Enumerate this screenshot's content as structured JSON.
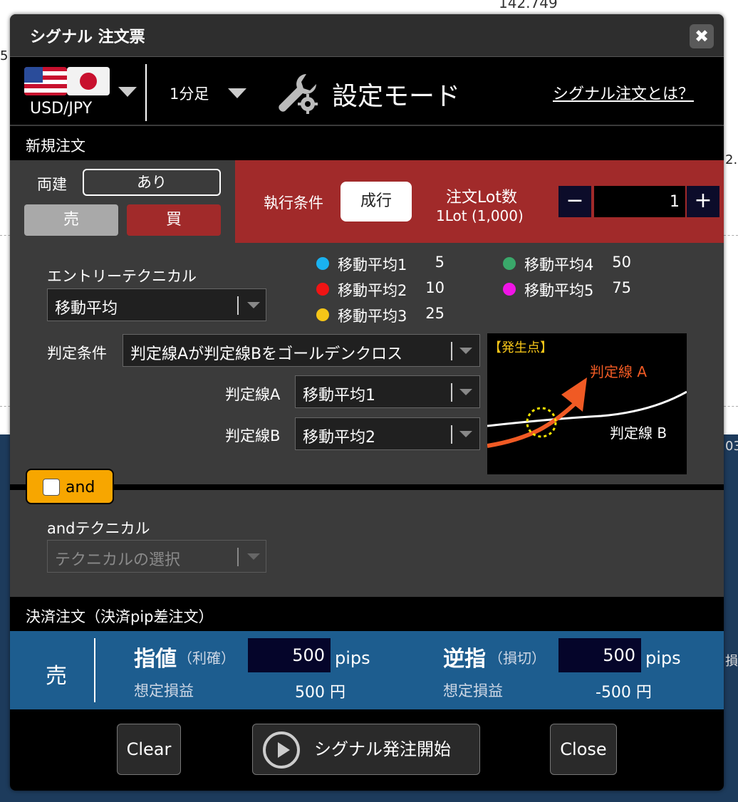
{
  "background": {
    "price_label": "142.749",
    "edge_texts": [
      "5",
      "2.",
      "03",
      "損"
    ]
  },
  "dialog": {
    "title": "シグナル 注文票",
    "close_icon": "close-icon"
  },
  "header": {
    "pair": "USD/JPY",
    "timeframe": "1分足",
    "mode": "設定モード",
    "help_link": "シグナル注文とは？"
  },
  "new_order": {
    "section_title": "新規注文",
    "hedge_label": "両建",
    "hedge_value": "あり",
    "sell": "売",
    "buy": "買",
    "exec_label": "執行条件",
    "exec_value": "成行",
    "lot_title": "注文Lot数",
    "lot_sub": "1Lot (1,000)",
    "lot_value": "1",
    "minus": "−",
    "plus": "+"
  },
  "entry": {
    "label": "エントリーテクニカル",
    "selected": "移動平均",
    "moving_averages": [
      {
        "name": "移動平均1",
        "value": "5",
        "color": "#1ab2f0"
      },
      {
        "name": "移動平均2",
        "value": "10",
        "color": "#f01414"
      },
      {
        "name": "移動平均3",
        "value": "25",
        "color": "#f5c518"
      },
      {
        "name": "移動平均4",
        "value": "50",
        "color": "#3aa86a"
      },
      {
        "name": "移動平均5",
        "value": "75",
        "color": "#f014e6"
      }
    ],
    "condition_label": "判定条件",
    "condition_value": "判定線Aが判定線Bをゴールデンクロス",
    "line_a_label": "判定線A",
    "line_a_value": "移動平均1",
    "line_b_label": "判定線B",
    "line_b_value": "移動平均2"
  },
  "diagram": {
    "title": "【発生点】",
    "line_a": "判定線 A",
    "line_b": "判定線 B"
  },
  "and_section": {
    "tab_label": "and",
    "checked": false,
    "technical_label": "andテクニカル",
    "technical_placeholder": "テクニカルの選択"
  },
  "settlement": {
    "section_title": "決済注文（決済pip差注文）",
    "side": "売",
    "limit_label": "指値",
    "limit_sub": "（利確）",
    "limit_pips": "500",
    "stop_label": "逆指",
    "stop_sub": "（損切）",
    "stop_pips": "500",
    "pips_unit": "pips",
    "expected_pl_label": "想定損益",
    "limit_pl": "500 円",
    "stop_pl": "-500 円"
  },
  "footer": {
    "clear": "Clear",
    "start": "シグナル発注開始",
    "close": "Close"
  }
}
